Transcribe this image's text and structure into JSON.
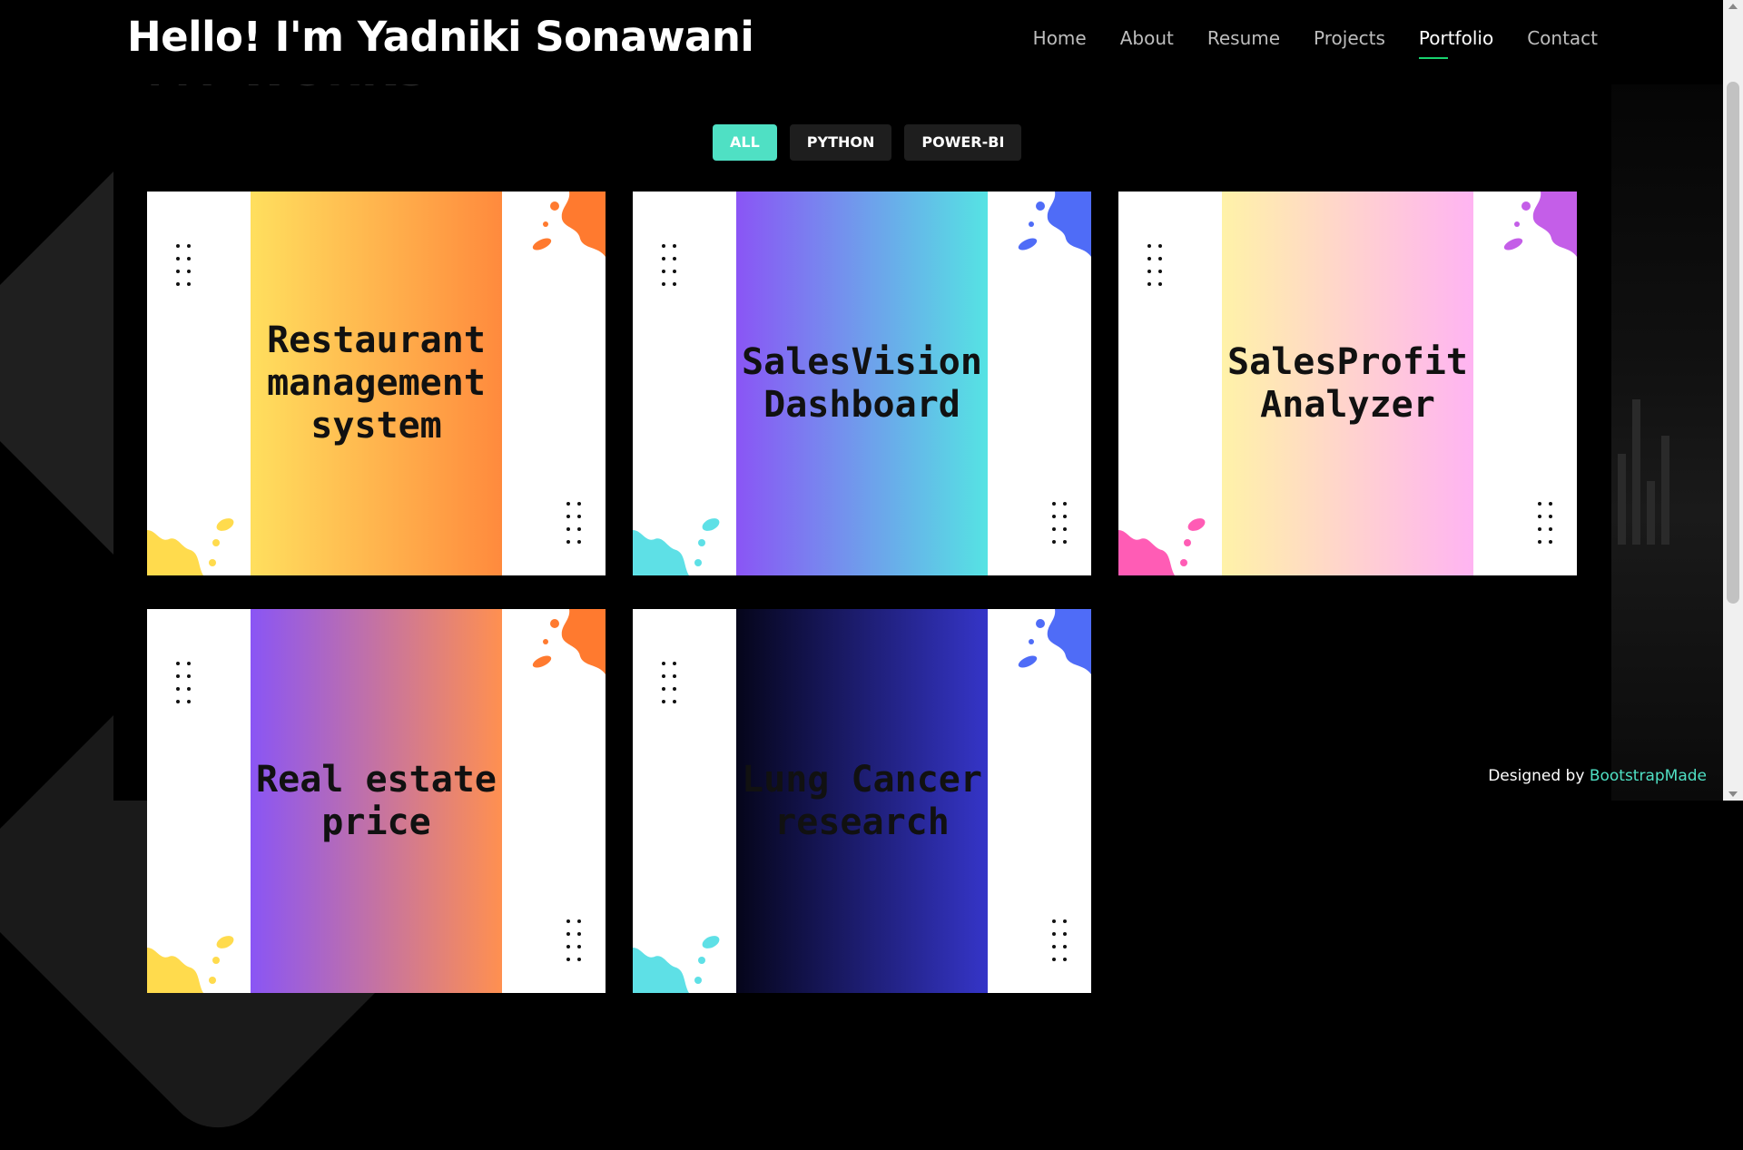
{
  "header": {
    "brand": "Hello! I'm Yadniki Sonawani",
    "nav": [
      {
        "label": "Home",
        "active": false
      },
      {
        "label": "About",
        "active": false
      },
      {
        "label": "Resume",
        "active": false
      },
      {
        "label": "Projects",
        "active": false
      },
      {
        "label": "Portfolio",
        "active": true
      },
      {
        "label": "Contact",
        "active": false
      }
    ]
  },
  "section": {
    "title": "MY WORKS"
  },
  "filters": [
    {
      "label": "ALL",
      "active": true
    },
    {
      "label": "PYTHON",
      "active": false
    },
    {
      "label": "POWER-BI",
      "active": false
    }
  ],
  "projects": [
    {
      "title": "Restaurant management system",
      "gradient": [
        "#ffdf5e",
        "#ff8a3d"
      ],
      "splash_top": "#ff7a2f",
      "splash_bottom": "#ffdb4d"
    },
    {
      "title": "SalesVision Dashboard",
      "gradient": [
        "#8a55f5",
        "#55e3e3"
      ],
      "splash_top": "#4f6cf7",
      "splash_bottom": "#5ee0e6"
    },
    {
      "title": "SalesProfit Analyzer",
      "gradient": [
        "#fff2a8",
        "#ffb4f2"
      ],
      "splash_top": "#c45ee8",
      "splash_bottom": "#ff5cb5"
    },
    {
      "title": "Real estate price",
      "gradient": [
        "#8a55f5",
        "#ff9050"
      ],
      "splash_top": "#ff7a2f",
      "splash_bottom": "#ffdb4d"
    },
    {
      "title": "Lung Cancer research",
      "gradient": [
        "#05051a",
        "#3535c8"
      ],
      "splash_top": "#4f6cf7",
      "splash_bottom": "#5ee0e6"
    }
  ],
  "footer": {
    "credit_prefix": "Designed by ",
    "credit_link": "BootstrapMade"
  },
  "colors": {
    "accent": "#4fe0c4",
    "nav_underline": "#18d26e"
  }
}
